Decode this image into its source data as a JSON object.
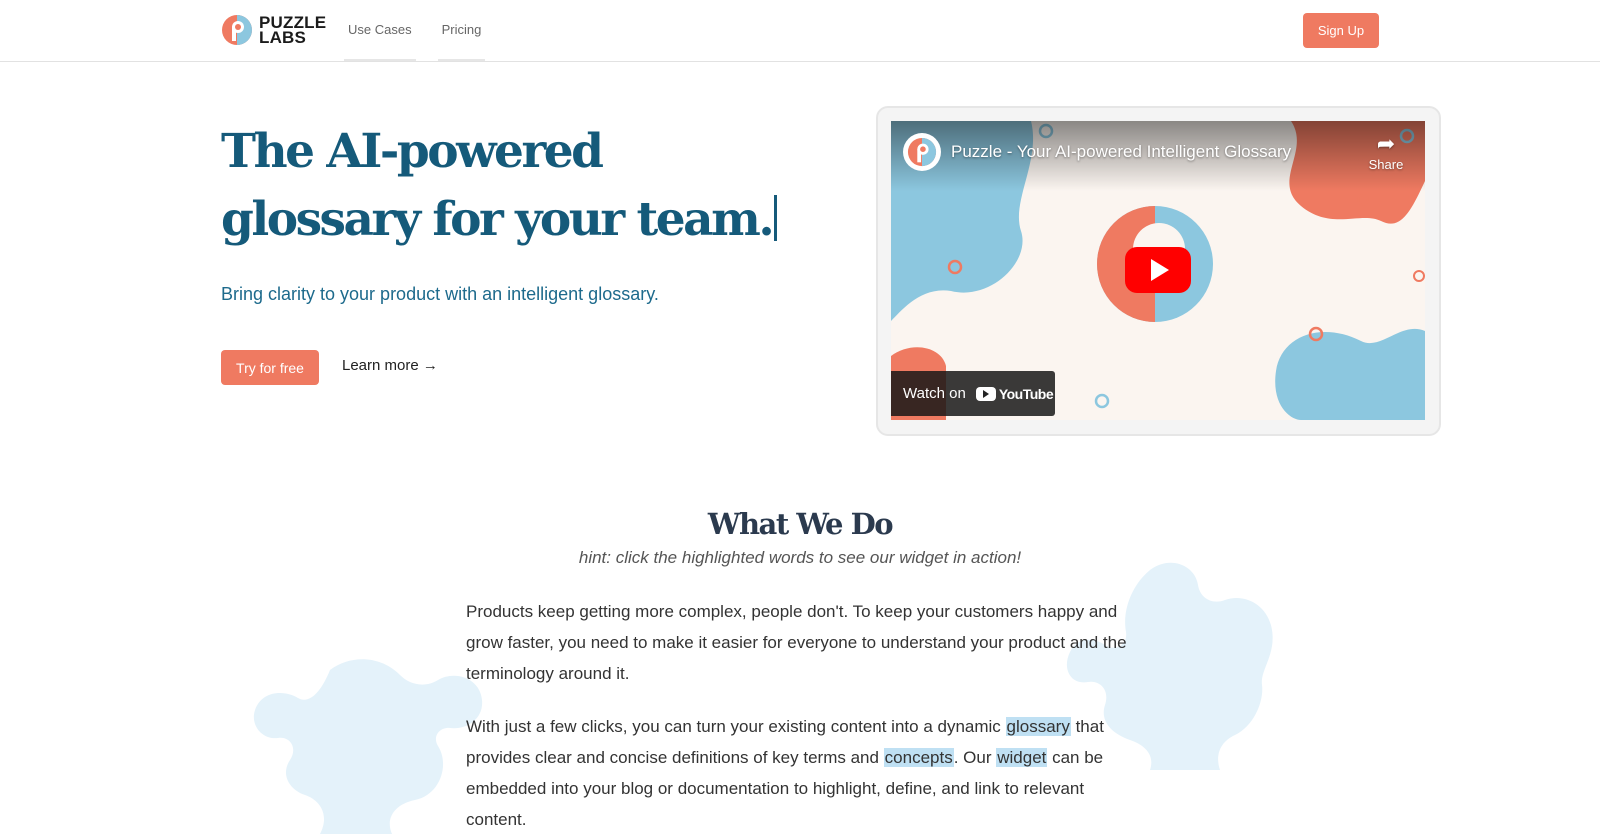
{
  "header": {
    "logo_line1": "PUZZLE",
    "logo_line2": "LABS",
    "nav": [
      {
        "label": "Use Cases"
      },
      {
        "label": "Pricing"
      }
    ],
    "signup_label": "Sign Up"
  },
  "hero": {
    "title": "The AI-powered glossary for your team.",
    "subtitle": "Bring clarity to your product with an intelligent glossary.",
    "cta_primary": "Try for free",
    "cta_secondary": "Learn more →"
  },
  "video": {
    "title": "Puzzle - Your AI-powered Intelligent Glossary",
    "share_label": "Share",
    "watch_on_label": "Watch on",
    "youtube_label": "YouTube",
    "colors": {
      "coral": "#ef7a61",
      "blue": "#8cc7df",
      "cream": "#fbf5f0"
    }
  },
  "what_we_do": {
    "title": "What We Do",
    "hint": "hint: click the highlighted words to see our widget in action!",
    "p1": "Products keep getting more complex, people don't. To keep your customers happy and grow faster, you need to make it easier for everyone to understand your product and the terminology around it.",
    "p2_part1": "With just a few clicks, you can turn your existing content into a dynamic ",
    "p2_term1": "glossary",
    "p2_part2": " that provides clear and concise definitions of key terms and ",
    "p2_term2": "concepts",
    "p2_part3": ". Our ",
    "p2_term3": "widget",
    "p2_part4": " can be embedded into your blog or documentation to highlight, define, and link to relevant content."
  },
  "colors": {
    "accent": "#ef7a61",
    "heading_blue": "#155a7a",
    "highlight": "#bfe0f3",
    "puzzle_bg": "#e4f2fa"
  }
}
